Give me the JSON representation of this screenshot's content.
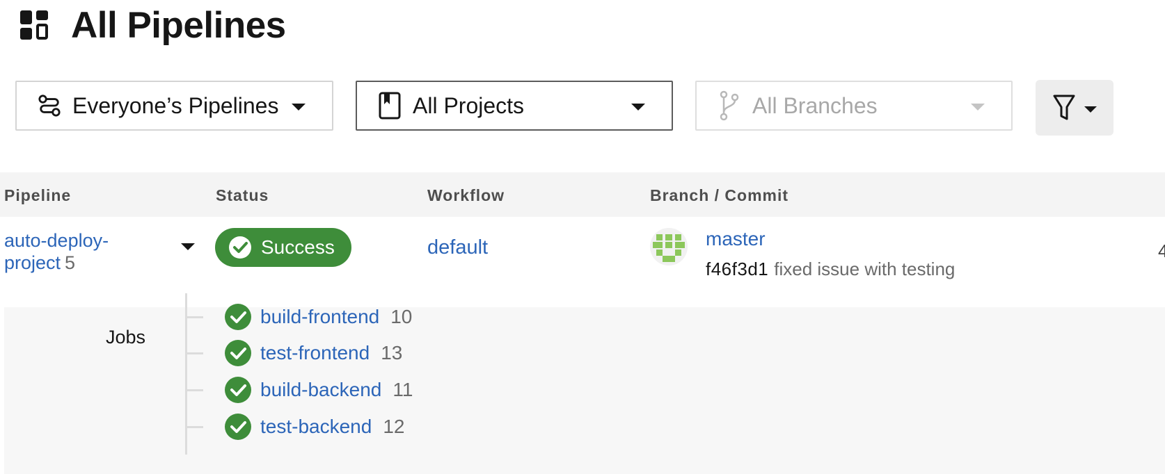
{
  "header": {
    "title": "All Pipelines",
    "icon": "dashboard-icon"
  },
  "filters": {
    "pipelines": {
      "label": "Everyone’s Pipelines",
      "icon": "pipelines-icon"
    },
    "projects": {
      "label": "All Projects",
      "icon": "bookmark-icon"
    },
    "branches": {
      "label": "All Branches",
      "icon": "git-branch-icon",
      "disabled": true
    },
    "filter_button": {
      "icon": "funnel-icon"
    }
  },
  "table": {
    "columns": [
      "Pipeline",
      "Status",
      "Workflow",
      "Branch / Commit"
    ],
    "rows": [
      {
        "pipeline_line1": "auto-deploy-",
        "pipeline_line2": "project",
        "number": "5",
        "status": "Success",
        "workflow": "default",
        "branch": "master",
        "commit_hash": "f46f3d1",
        "commit_message": "fixed issue with testing",
        "edge_text": "4"
      }
    ]
  },
  "jobs": {
    "label": "Jobs",
    "items": [
      {
        "name": "build-frontend",
        "number": "10"
      },
      {
        "name": "test-frontend",
        "number": "13"
      },
      {
        "name": "build-backend",
        "number": "11"
      },
      {
        "name": "test-backend",
        "number": "12"
      }
    ]
  },
  "colors": {
    "success": "#3e8d3a",
    "link": "#2c65b8",
    "avatar": "#8cc75b"
  }
}
